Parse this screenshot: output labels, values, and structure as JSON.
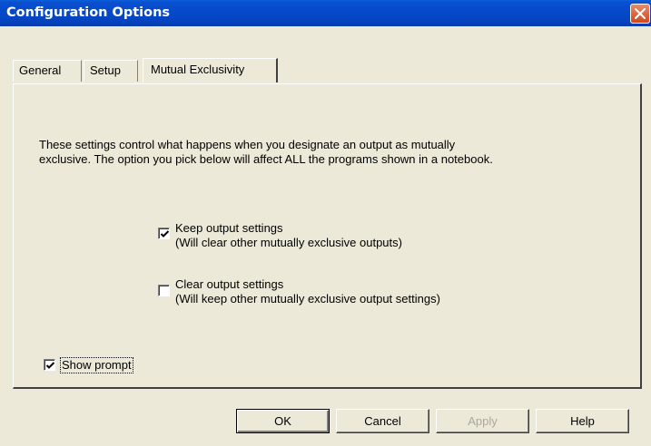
{
  "window": {
    "title": "Configuration Options",
    "close_icon": "close-icon"
  },
  "tabs": [
    {
      "label": "General",
      "active": false
    },
    {
      "label": "Setup",
      "active": false
    },
    {
      "label": "Mutual Exclusivity",
      "active": true
    }
  ],
  "panel": {
    "description_line1": "These settings control what happens when you designate an output as mutually",
    "description_line2": "exclusive. The option you pick below will affect ALL the programs shown in a notebook.",
    "options": [
      {
        "label": "Keep output settings",
        "sublabel": "(Will clear other mutually exclusive outputs)",
        "checked": true
      },
      {
        "label": "Clear output settings",
        "sublabel": "(Will keep other mutually exclusive output settings)",
        "checked": false
      }
    ],
    "show_prompt": {
      "label": "Show prompt",
      "checked": true
    }
  },
  "buttons": {
    "ok": "OK",
    "cancel": "Cancel",
    "apply": "Apply",
    "help": "Help"
  },
  "colors": {
    "titlebar": "#0549c9",
    "dialog_bg": "#ece9d8",
    "close_button": "#d2461c",
    "disabled_text": "#aca899"
  }
}
